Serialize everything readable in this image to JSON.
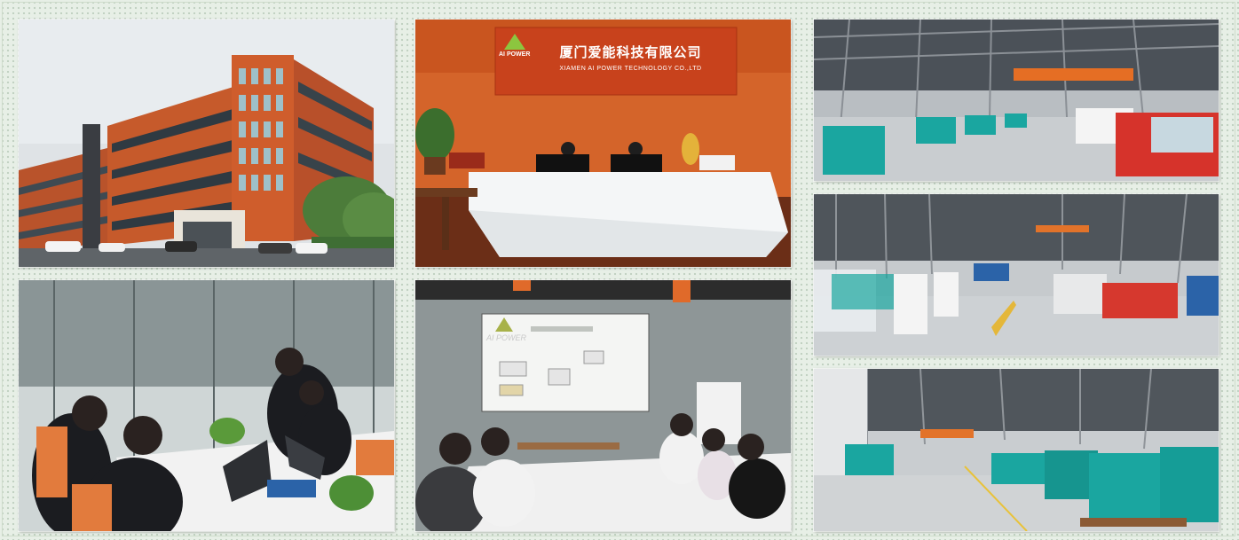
{
  "company_sign": {
    "chinese_name": "厦门爱能科技有限公司",
    "english_name": "XIAMEN AI POWER TECHNOLOGY CO.,LTD",
    "brand": "AI POWER"
  },
  "projector": {
    "brand": "AI POWER"
  },
  "photos": [
    {
      "subject": "building-exterior"
    },
    {
      "subject": "reception-desk"
    },
    {
      "subject": "generator-warehouse"
    },
    {
      "subject": "meeting-room"
    },
    {
      "subject": "training-room"
    },
    {
      "subject": "generator-storage"
    },
    {
      "subject": "generator-production-line"
    }
  ],
  "colors": {
    "background": "#e7efe6",
    "building_orange": "#c65a2b",
    "reception_wall": "#d4642a",
    "sign_red": "#c8421c",
    "generator_teal": "#1aa6a0",
    "floor_gray": "#c9cdd0"
  }
}
